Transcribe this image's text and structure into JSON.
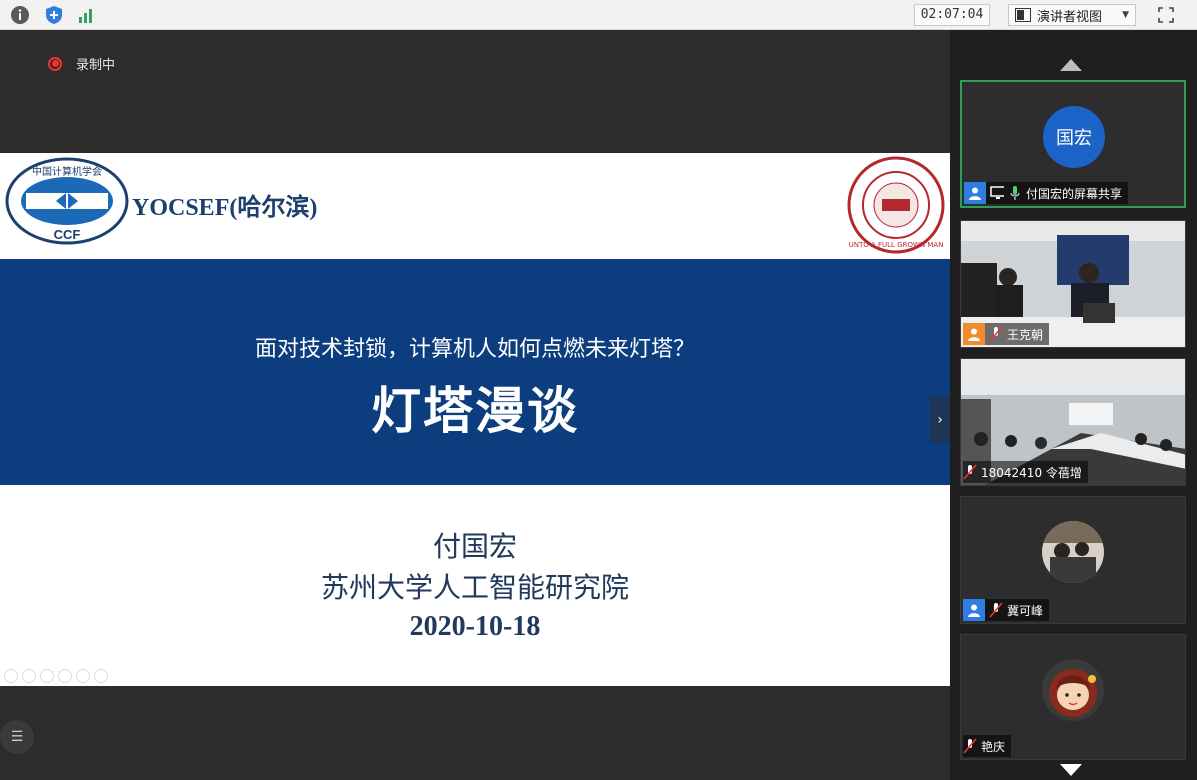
{
  "topbar": {
    "timer": "02:07:04",
    "view_mode": "演讲者视图"
  },
  "stage": {
    "recording_label": "录制中"
  },
  "slide": {
    "org_logo_text": "中国计算机学会",
    "org_logo_abbr": "CCF",
    "org_name": "YOCSEF(哈尔滨)",
    "seal_text": "UNTO A FULL GROWN MAN",
    "subtitle": "面对技术封锁，计算机人如何点燃未来灯塔？",
    "title": "灯塔漫谈",
    "author": "付国宏",
    "institution": "苏州大学人工智能研究院",
    "date": "2020-10-18"
  },
  "participants": [
    {
      "name": "付国宏的屏幕共享",
      "avatar_text": "国宏",
      "kind": "avatar",
      "active": true
    },
    {
      "name": "王克朝",
      "kind": "video"
    },
    {
      "name": "18042410 令蓓增",
      "kind": "video"
    },
    {
      "name": "冀可峰",
      "kind": "photo-avatar"
    },
    {
      "name": "艳庆",
      "kind": "cartoon-avatar"
    }
  ],
  "colors": {
    "slide_band": "#0b3d7f",
    "active_border": "#2f9e5a",
    "avatar_blue": "#1b63c6",
    "record_red": "#e33333"
  }
}
